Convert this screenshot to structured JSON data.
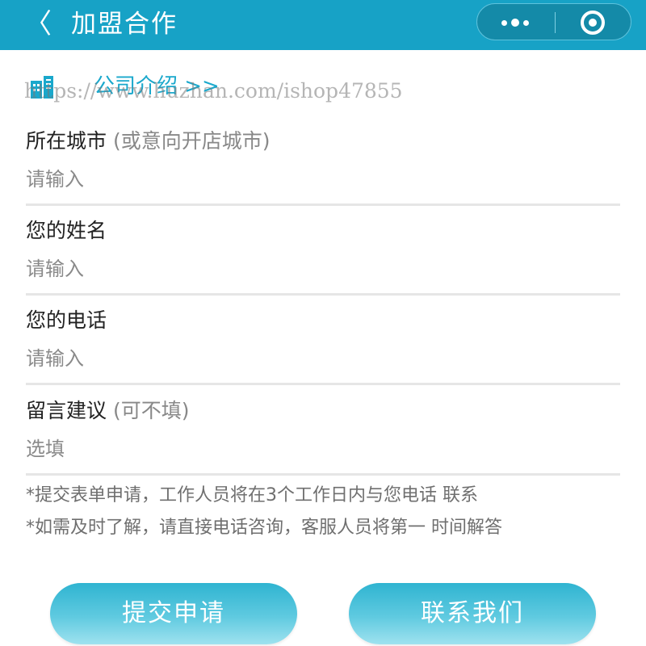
{
  "header": {
    "back_icon": "chevron-left-icon",
    "back_glyph": "〈",
    "title": "加盟合作",
    "more_icon": "more-dots-icon",
    "close_icon": "target-circle-icon",
    "bar_color": "#17a2c6"
  },
  "intro": {
    "icon": "building-icon",
    "link_text": "公司介绍 >>",
    "accent_color": "#1aa8cc"
  },
  "watermark": "https://www.huzhan.com/ishop47855",
  "form": {
    "fields": [
      {
        "label": "所在城市",
        "hint": " (或意向开店城市)",
        "placeholder": "请输入"
      },
      {
        "label": "您的姓名",
        "hint": "",
        "placeholder": "请输入"
      },
      {
        "label": "您的电话",
        "hint": "",
        "placeholder": "请输入"
      },
      {
        "label": "留言建议",
        "hint": " (可不填)",
        "placeholder": "选填"
      }
    ]
  },
  "notes": [
    "*提交表单申请，工作人员将在3个工作日内与您电话 联系",
    "*如需及时了解，请直接电话咨询，客服人员将第一 时间解答"
  ],
  "buttons": {
    "submit_label": "提交申请",
    "contact_label": "联系我们"
  }
}
